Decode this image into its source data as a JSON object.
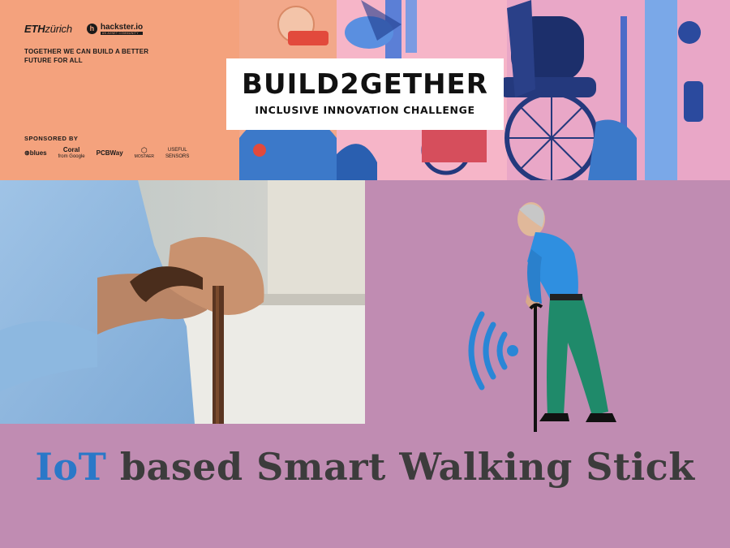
{
  "banner": {
    "eth_bold": "ETH",
    "eth_light": "zürich",
    "hackster_icon": "h",
    "hackster_name": "hackster.io",
    "hackster_sub": "AN AVNET COMMUNITY",
    "tagline": "TOGETHER WE CAN BUILD A BETTER FUTURE FOR ALL",
    "sponsored_label": "SPONSORED BY",
    "sponsors": {
      "blues": "⊛blues",
      "coral": "Coral",
      "coral_sub": "from Google",
      "pcbway": "PCBWay",
      "mostaer": "MOSTAER",
      "useful": "USEFUL",
      "sensors": "SENSORS"
    },
    "title": "BUILD2GETHER",
    "subtitle": "INCLUSIVE  INNOVATION CHALLENGE"
  },
  "heading": {
    "iot": "IoT",
    "rest": " based Smart Walking Stick"
  },
  "colors": {
    "banner_bg": "#f4a27d",
    "page_bg": "#c08cb2",
    "heading_accent": "#2a78c8",
    "heading_text": "#3c3c3c",
    "wifi": "#2a86d6"
  },
  "icons": [
    "wifi-signal-icon",
    "wheelchair-illustration",
    "walking-stick"
  ]
}
